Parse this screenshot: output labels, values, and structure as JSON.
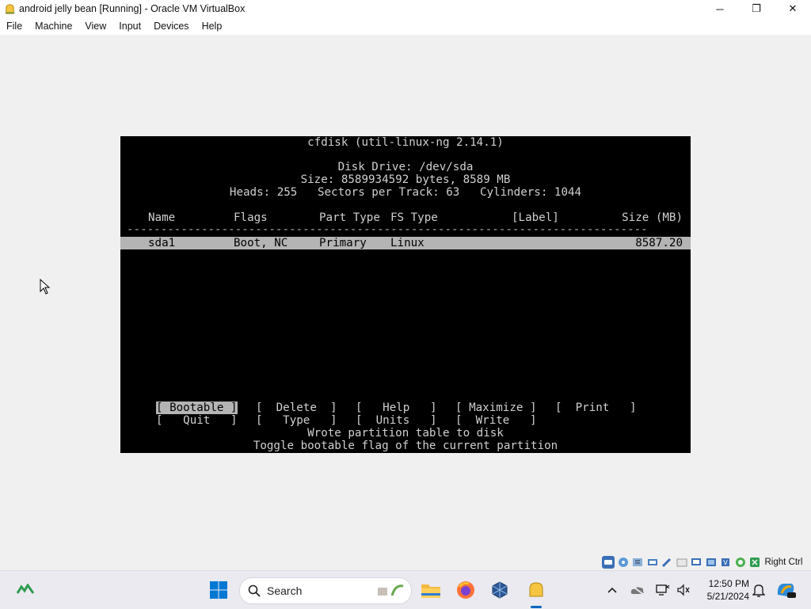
{
  "window": {
    "title": "android jelly bean [Running] - Oracle VM VirtualBox",
    "minimize_glyph": "─",
    "maximize_glyph": "❐",
    "close_glyph": "✕"
  },
  "menubar": {
    "items": [
      "File",
      "Machine",
      "View",
      "Input",
      "Devices",
      "Help"
    ]
  },
  "console": {
    "program_title": "cfdisk (util-linux-ng 2.14.1)",
    "disk_drive": "Disk Drive: /dev/sda",
    "size_line": "Size: 8589934592 bytes, 8589 MB",
    "geometry_line": "Heads: 255   Sectors per Track: 63   Cylinders: 1044",
    "columns": {
      "name": "Name",
      "flags": "Flags",
      "part_type": "Part Type",
      "fs_type": "FS Type",
      "label": "[Label]",
      "size": "Size (MB)"
    },
    "dashes": "-----------------------------------------------------------------------------",
    "partitions": [
      {
        "name": "sda1",
        "flags": "Boot, NC",
        "part_type": "Primary",
        "fs_type": "Linux",
        "label": "",
        "size": "8587.20"
      }
    ],
    "menu_row1": [
      "[ Bootable ]",
      "[  Delete  ]",
      "[   Help   ]",
      "[ Maximize ]",
      "[  Print   ]"
    ],
    "menu_row2": [
      "[   Quit   ]",
      "[   Type   ]",
      "[  Units   ]",
      "[  Write   ]"
    ],
    "selected_menu": "[ Bootable ]",
    "status_message": "Wrote partition table to disk",
    "help_text": "Toggle bootable flag of the current partition"
  },
  "vm_statusbar": {
    "icons": [
      "hard-disk-icon",
      "optical-drive-icon",
      "audio-icon",
      "network-icon",
      "usb-icon",
      "shared-folders-icon",
      "display-icon",
      "video-capture-icon",
      "cpu-icon",
      "recording-icon",
      "mouse-integration-icon"
    ],
    "host_key": "Right Ctrl"
  },
  "taskbar": {
    "search_placeholder": "Search",
    "time": "12:50 PM",
    "date": "5/21/2024"
  },
  "colors": {
    "console_bg": "#000000",
    "console_fg": "#d0d0d0",
    "selection_bg": "#b4b4b4",
    "accent": "#0067c0"
  }
}
